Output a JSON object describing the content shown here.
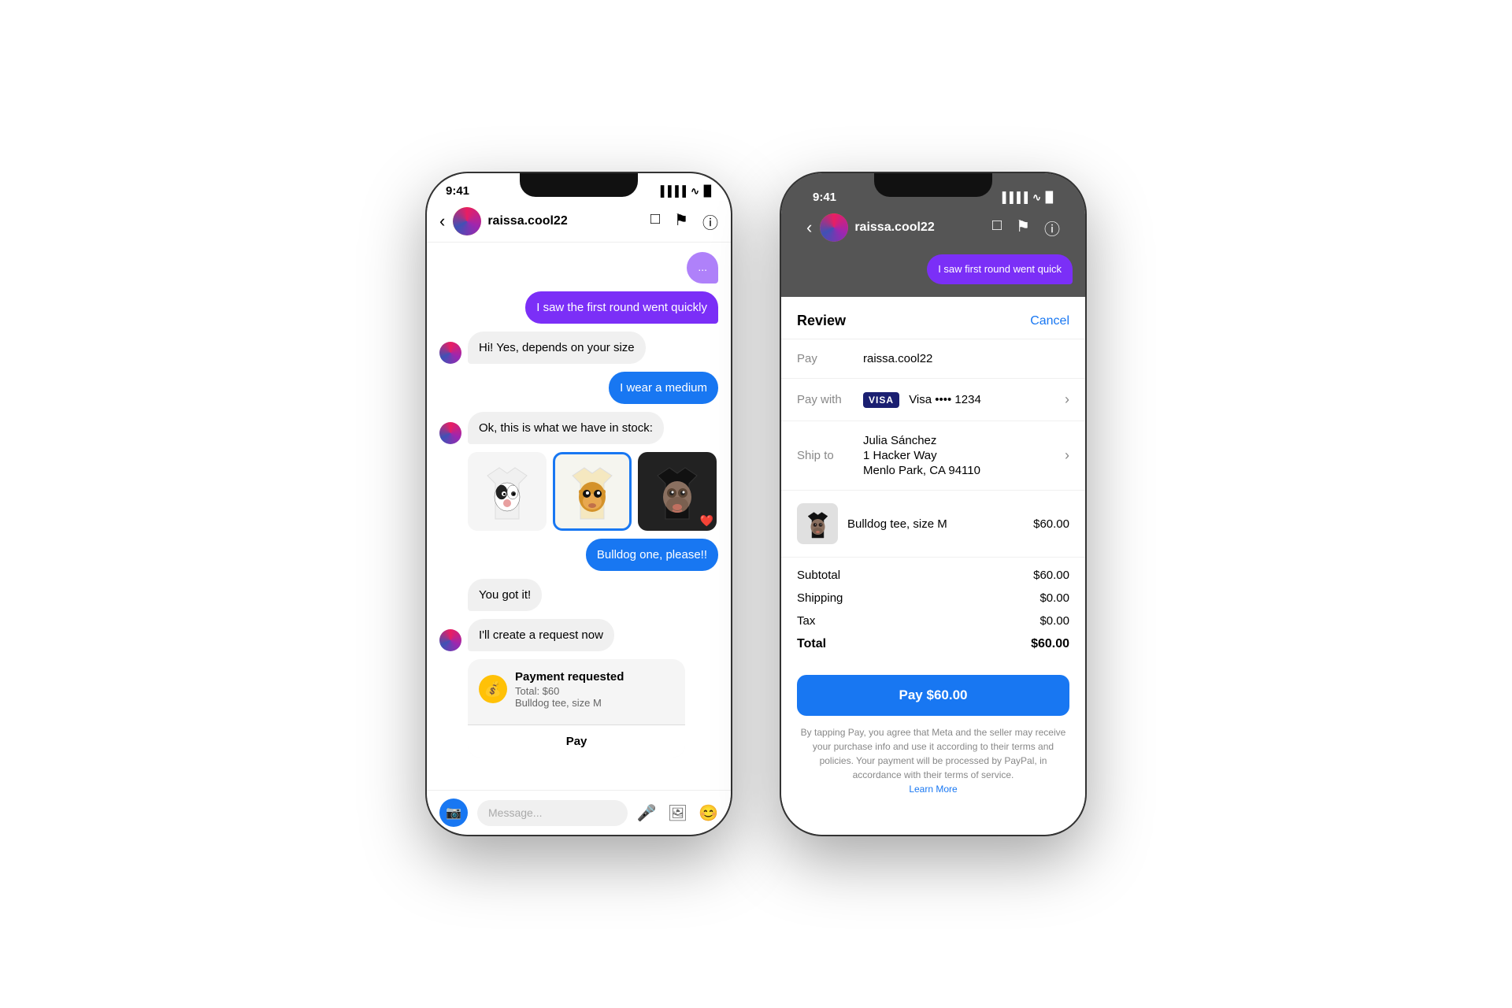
{
  "phone1": {
    "status_time": "9:41",
    "nav_name": "raissa.cool22",
    "chat": {
      "bubble1": "I saw the first round went quickly",
      "bubble2": "Hi! Yes, depends on your size",
      "bubble3": "I wear a medium",
      "bubble4": "Ok, this is what we have in stock:",
      "bubble5": "Bulldog one, please!!",
      "bubble6": "You got it!",
      "bubble7": "I'll create a request now",
      "payment_title": "Payment requested",
      "payment_total": "Total: $60",
      "payment_item": "Bulldog tee, size M",
      "payment_btn": "Pay"
    },
    "input_placeholder": "Message..."
  },
  "phone2": {
    "status_time": "9:41",
    "nav_name": "raissa.cool22",
    "partial_bubble": "I saw first round went quick",
    "review": {
      "title": "Review",
      "cancel": "Cancel",
      "pay_label": "Pay",
      "pay_value": "raissa.cool22",
      "pay_with_label": "Pay with",
      "visa_text": "VISA",
      "visa_last4": "Visa •••• 1234",
      "ship_label": "Ship to",
      "ship_name": "Julia Sánchez",
      "ship_address": "1 Hacker Way",
      "ship_city": "Menlo Park, CA 94110",
      "product_desc": "Bulldog tee, size M",
      "product_price": "$60.00",
      "subtotal_label": "Subtotal",
      "subtotal_value": "$60.00",
      "shipping_label": "Shipping",
      "shipping_value": "$0.00",
      "tax_label": "Tax",
      "tax_value": "$0.00",
      "total_label": "Total",
      "total_value": "$60.00",
      "pay_btn": "Pay $60.00",
      "fine_print": "By tapping Pay, you agree that Meta and the seller may receive your purchase info and use it according to their terms and policies. Your payment will be processed by PayPal, in accordance with their terms of service.",
      "learn_more": "Learn More"
    }
  }
}
